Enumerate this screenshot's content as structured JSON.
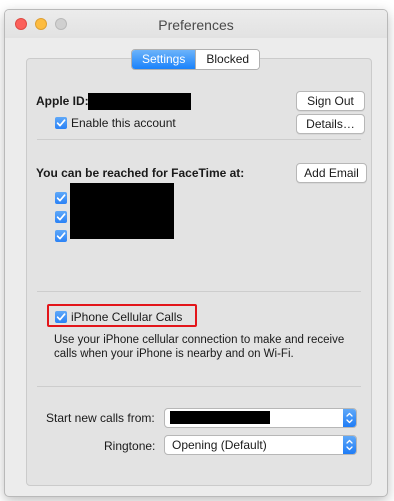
{
  "window": {
    "title": "Preferences"
  },
  "tabs": {
    "settings": "Settings",
    "blocked": "Blocked"
  },
  "account": {
    "apple_id_label": "Apple ID:",
    "sign_out": "Sign Out",
    "enable_label": "Enable this account",
    "details": "Details…"
  },
  "reach": {
    "label": "You can be reached for FaceTime at:",
    "add_email": "Add Email"
  },
  "cellular": {
    "checkbox_label": "iPhone Cellular Calls",
    "description": "Use your iPhone cellular connection to make and receive calls when your iPhone is nearby and on Wi-Fi."
  },
  "calls": {
    "start_label": "Start new calls from:",
    "ringtone_label": "Ringtone:",
    "ringtone_value": "Opening (Default)"
  },
  "colors": {
    "accent": "#2b82f6",
    "highlight_border": "#e3151a"
  }
}
